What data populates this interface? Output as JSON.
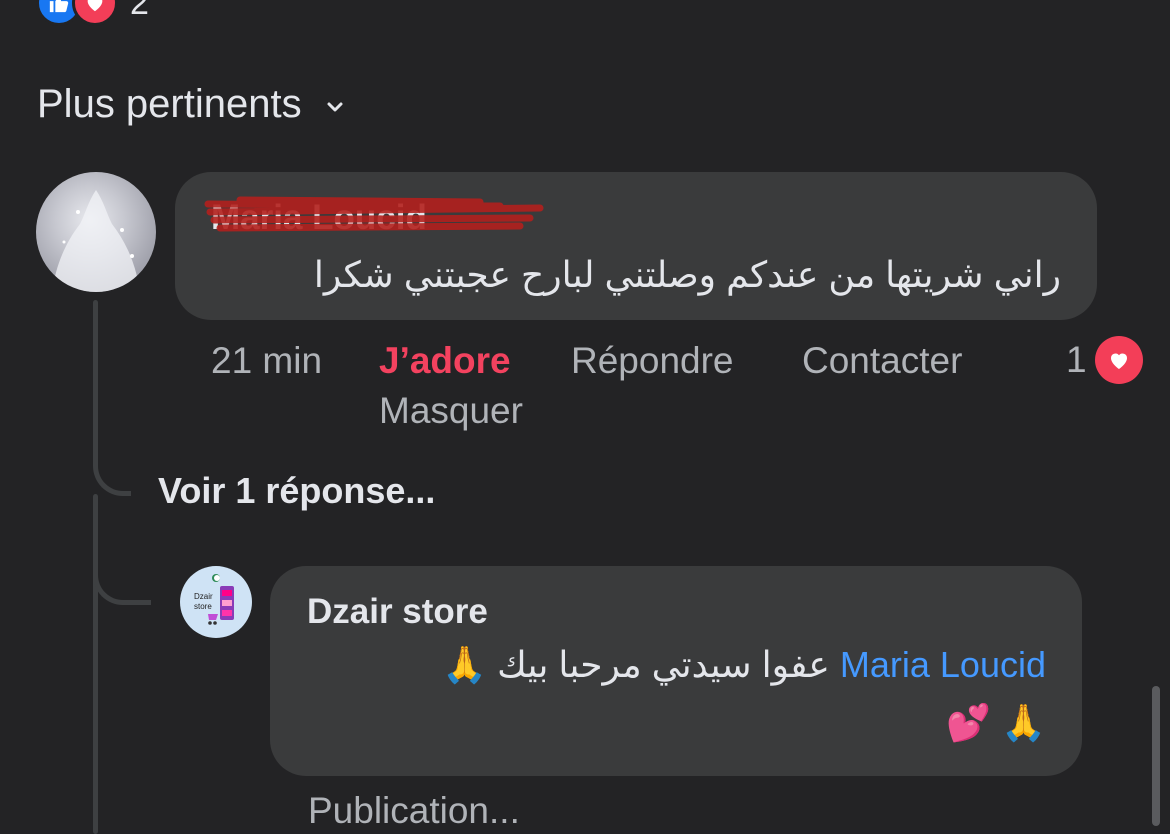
{
  "reactions": {
    "count": "2",
    "icons": [
      "like-icon",
      "love-icon"
    ]
  },
  "sort": {
    "label": "Plus pertinents",
    "icon": "chevron-down-icon"
  },
  "comment": {
    "author": "Maria Loucid",
    "text": "راني شريتها من عندكم وصلتني لبارح عجبتني شكرا",
    "time": "21 min",
    "actions": {
      "love": "J’adore",
      "reply": "Répondre",
      "contact": "Contacter",
      "hide": "Masquer"
    },
    "love_count": "1"
  },
  "see_replies": "Voir 1 réponse...",
  "reply": {
    "author": "Dzair store",
    "mention": "Maria Loucid",
    "text": "عفوا سيدتي مرحبا بيك",
    "emoji_1": "🙏",
    "emoji_line2": "🙏 💕",
    "avatar_text_1": "Dzair",
    "avatar_text_2": "store",
    "footer": "Publication..."
  },
  "colors": {
    "background": "#232325",
    "bubble": "#3a3b3c",
    "love": "#f3425f",
    "mention": "#4599ff",
    "like": "#1877f2"
  }
}
